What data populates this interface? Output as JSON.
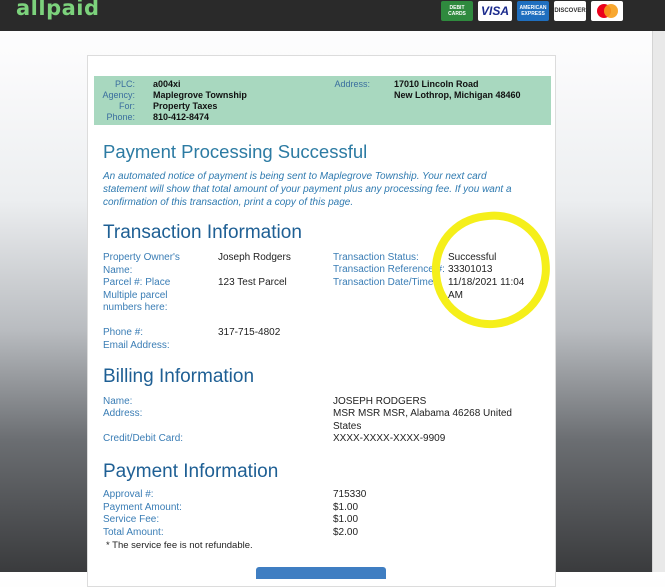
{
  "header": {
    "logo": "allpaid"
  },
  "accepted_cards": [
    {
      "name": "debit-card-icon",
      "label": "DEBIT CARDS"
    },
    {
      "name": "visa-icon",
      "label": "VISA"
    },
    {
      "name": "amex-icon",
      "label": "AMERICAN EXPRESS"
    },
    {
      "name": "discover-icon",
      "label": "DISCOVER"
    },
    {
      "name": "mastercard-icon",
      "label": ""
    }
  ],
  "info": {
    "plc_label": "PLC:",
    "plc": "a004xi",
    "agency_label": "Agency:",
    "agency": "Maplegrove Township",
    "for_label": "For:",
    "for": "Property Taxes",
    "phone_label": "Phone:",
    "phone": "810-412-8474",
    "address_label": "Address:",
    "address_line1": "17010 Lincoln Road",
    "address_line2": "New Lothrop, Michigan 48460"
  },
  "result": {
    "title": "Payment Processing Successful",
    "notice": "An automated notice of payment is being sent to Maplegrove Township. Your next card statement will show that total amount of your payment plus any processing fee. If you want a confirmation of this transaction, print a copy of this page."
  },
  "transaction": {
    "heading": "Transaction Information",
    "owner_label": "Property Owner's Name:",
    "owner": "Joseph Rodgers",
    "parcel_label": "Parcel #: Place Multiple parcel numbers here:",
    "parcel": "123 Test Parcel",
    "phone_label": "Phone #:",
    "phone": "317-715-4802",
    "email_label": "Email Address:",
    "status_label": "Transaction Status:",
    "status": "Successful",
    "ref_label": "Transaction Reference #:",
    "ref": "33301013",
    "date_label": "Transaction Date/Time:",
    "date": "11/18/2021 11:04 AM"
  },
  "billing": {
    "heading": "Billing Information",
    "name_label": "Name:",
    "name": "JOSEPH RODGERS",
    "address_label": "Address:",
    "address": "MSR MSR MSR, Alabama 46268 United States",
    "card_label": "Credit/Debit Card:",
    "card": "XXXX-XXXX-XXXX-9909"
  },
  "payment": {
    "heading": "Payment Information",
    "approval_label": "Approval #:",
    "approval": "715330",
    "amount_label": "Payment Amount:",
    "amount": "$1.00",
    "fee_label": "Service Fee:",
    "fee": "$1.00",
    "total_label": "Total Amount:",
    "total": "$2.00",
    "fee_note": "* The service fee is not refundable."
  },
  "colors": {
    "accent": "#2c7ba3",
    "band": "#a8d8bf",
    "highlight": "#f5ef1a"
  }
}
